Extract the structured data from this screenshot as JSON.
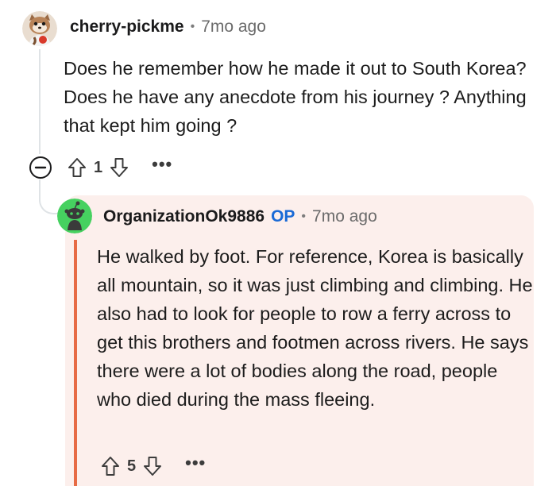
{
  "comments": [
    {
      "username": "cherry-pickme",
      "separator": "•",
      "time": "7mo ago",
      "body": "Does he remember how he made it out to South Korea? Does he have any anecdote from his journey ? Anything that kept him going ?",
      "votes": "1",
      "more": "•••"
    },
    {
      "username": "OrganizationOk9886",
      "op_badge": "OP",
      "separator": "•",
      "time": "7mo ago",
      "body": "He walked by foot. For reference, Korea is basically all mountain, so it was just climbing and climbing. He also had to look for people to row a ferry across to get this brothers and footmen across rivers. He says there were a lot of bodies along the road, people who died during the mass fleeing.",
      "votes": "5",
      "more": "•••"
    }
  ],
  "colors": {
    "op_badge": "#1a6ad6",
    "reply_background": "#fcefec",
    "reply_accent": "#e76b45",
    "avatar_green": "#46d160"
  },
  "icons": {
    "collapse": "minus-circle-icon",
    "upvote": "arrow-up-icon",
    "downvote": "arrow-down-icon",
    "more": "more-horizontal-icon"
  }
}
